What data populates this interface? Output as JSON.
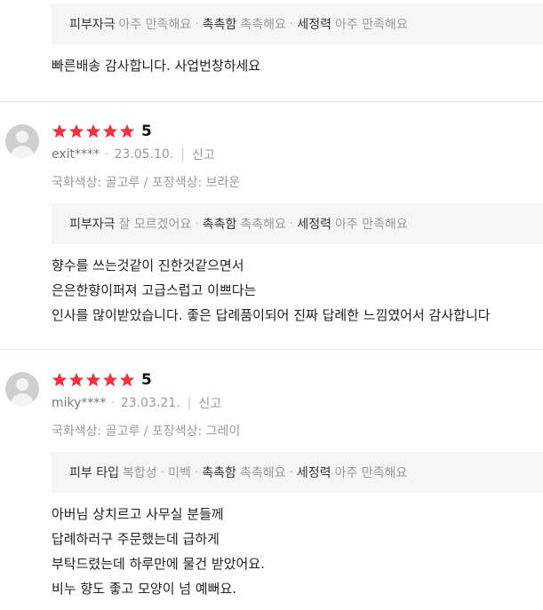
{
  "reviews": [
    {
      "attributes": [
        {
          "label": "피부자극",
          "value": "아주 만족해요"
        },
        {
          "label": "촉촉함",
          "value": "촉촉해요"
        },
        {
          "label": "세정력",
          "value": "아주 만족해요"
        }
      ],
      "content": [
        "빠른배송 감사합니다. 사업번창하세요"
      ]
    },
    {
      "rating": 5,
      "score": "5",
      "user": "exit****",
      "date": "23.05.10.",
      "report": "신고",
      "option": "국화색상: 골고루 / 포장색상: 브라운",
      "attributes": [
        {
          "label": "피부자극",
          "value": "잘 모르겠어요"
        },
        {
          "label": "촉촉함",
          "value": "촉촉해요"
        },
        {
          "label": "세정력",
          "value": "아주 만족해요"
        }
      ],
      "content": [
        "향수를 쓰는것같이 진한것같으면서",
        "은은한향이퍼져 고급스럽고 이쁘다는",
        "인사를 많이받았습니다. 좋은 답례품이되어 진짜 답례한 느낌였어서 감사합니다"
      ]
    },
    {
      "rating": 5,
      "score": "5",
      "user": "miky****",
      "date": "23.03.21.",
      "report": "신고",
      "option": "국화색상: 골고루 / 포장색상: 그레이",
      "attributes": [
        {
          "label": "피부 타입",
          "value": "복합성"
        },
        {
          "label": "미백",
          "value": ""
        },
        {
          "label": "촉촉함",
          "value": "촉촉해요"
        },
        {
          "label": "세정력",
          "value": "아주 만족해요"
        }
      ],
      "content": [
        "아버님 상치르고 사무실 분들께",
        "답례하러구 주문했는데 급하게",
        "부탁드렸는데 하루만에 물건 받았어요.",
        "비누 향도 좋고 모양이 넘 예뻐요."
      ]
    }
  ],
  "colors": {
    "star": "#f0323c",
    "attr_bg": "#f6f6f6",
    "divider": "#e6e6e6"
  },
  "icons": {
    "star": "star-icon",
    "avatar": "default-user-avatar-icon"
  }
}
